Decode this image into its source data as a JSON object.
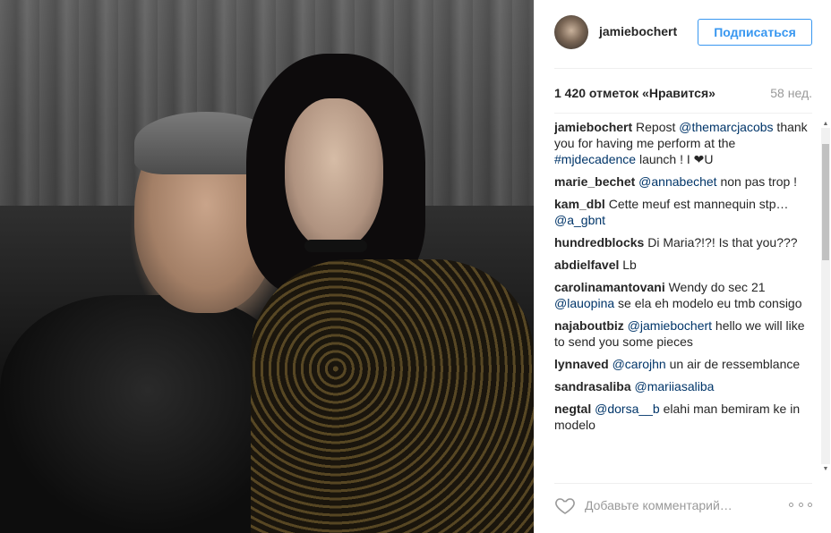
{
  "post": {
    "username": "jamiebochert",
    "follow_label": "Подписаться",
    "likes": "1 420 отметок «Нравится»",
    "time": "58 нед."
  },
  "comments": [
    {
      "user": "jamiebochert",
      "parts": [
        {
          "t": "Repost "
        },
        {
          "t": "@themarcjacobs",
          "m": true
        },
        {
          "t": " thank you for having me perform at the "
        },
        {
          "t": "#mjdecadence",
          "m": true
        },
        {
          "t": " launch ! I ❤U"
        }
      ]
    },
    {
      "user": "marie_bechet",
      "parts": [
        {
          "t": "@annabechet",
          "m": true
        },
        {
          "t": " non pas trop !"
        }
      ]
    },
    {
      "user": "kam_dbl",
      "parts": [
        {
          "t": "Cette meuf est mannequin stp… "
        },
        {
          "t": "@a_gbnt",
          "m": true
        }
      ]
    },
    {
      "user": "hundredblocks",
      "parts": [
        {
          "t": "Di Maria?!?! Is that you???"
        }
      ]
    },
    {
      "user": "abdielfavel",
      "parts": [
        {
          "t": "Lb"
        }
      ]
    },
    {
      "user": "carolinamantovani",
      "parts": [
        {
          "t": "Wendy do sec 21 "
        },
        {
          "t": "@lauopina",
          "m": true
        },
        {
          "t": " se ela eh modelo eu tmb consigo"
        }
      ]
    },
    {
      "user": "najaboutbiz",
      "parts": [
        {
          "t": "@jamiebochert",
          "m": true
        },
        {
          "t": " hello we will like to send you some pieces"
        }
      ]
    },
    {
      "user": "lynnaved",
      "parts": [
        {
          "t": "@carojhn",
          "m": true
        },
        {
          "t": " un air de ressemblance"
        }
      ]
    },
    {
      "user": "sandrasaliba",
      "parts": [
        {
          "t": "@mariiasaliba",
          "m": true
        }
      ]
    },
    {
      "user": "negtal",
      "parts": [
        {
          "t": "@dorsa__b",
          "m": true
        },
        {
          "t": " elahi man bemiram ke in modelo"
        }
      ]
    }
  ],
  "comment_box": {
    "placeholder": "Добавьте комментарий…"
  },
  "icons": {
    "like": "heart-icon",
    "more": "more-options-icon"
  },
  "colors": {
    "accent": "#3897f0",
    "mention": "#003569",
    "muted": "#999999"
  }
}
